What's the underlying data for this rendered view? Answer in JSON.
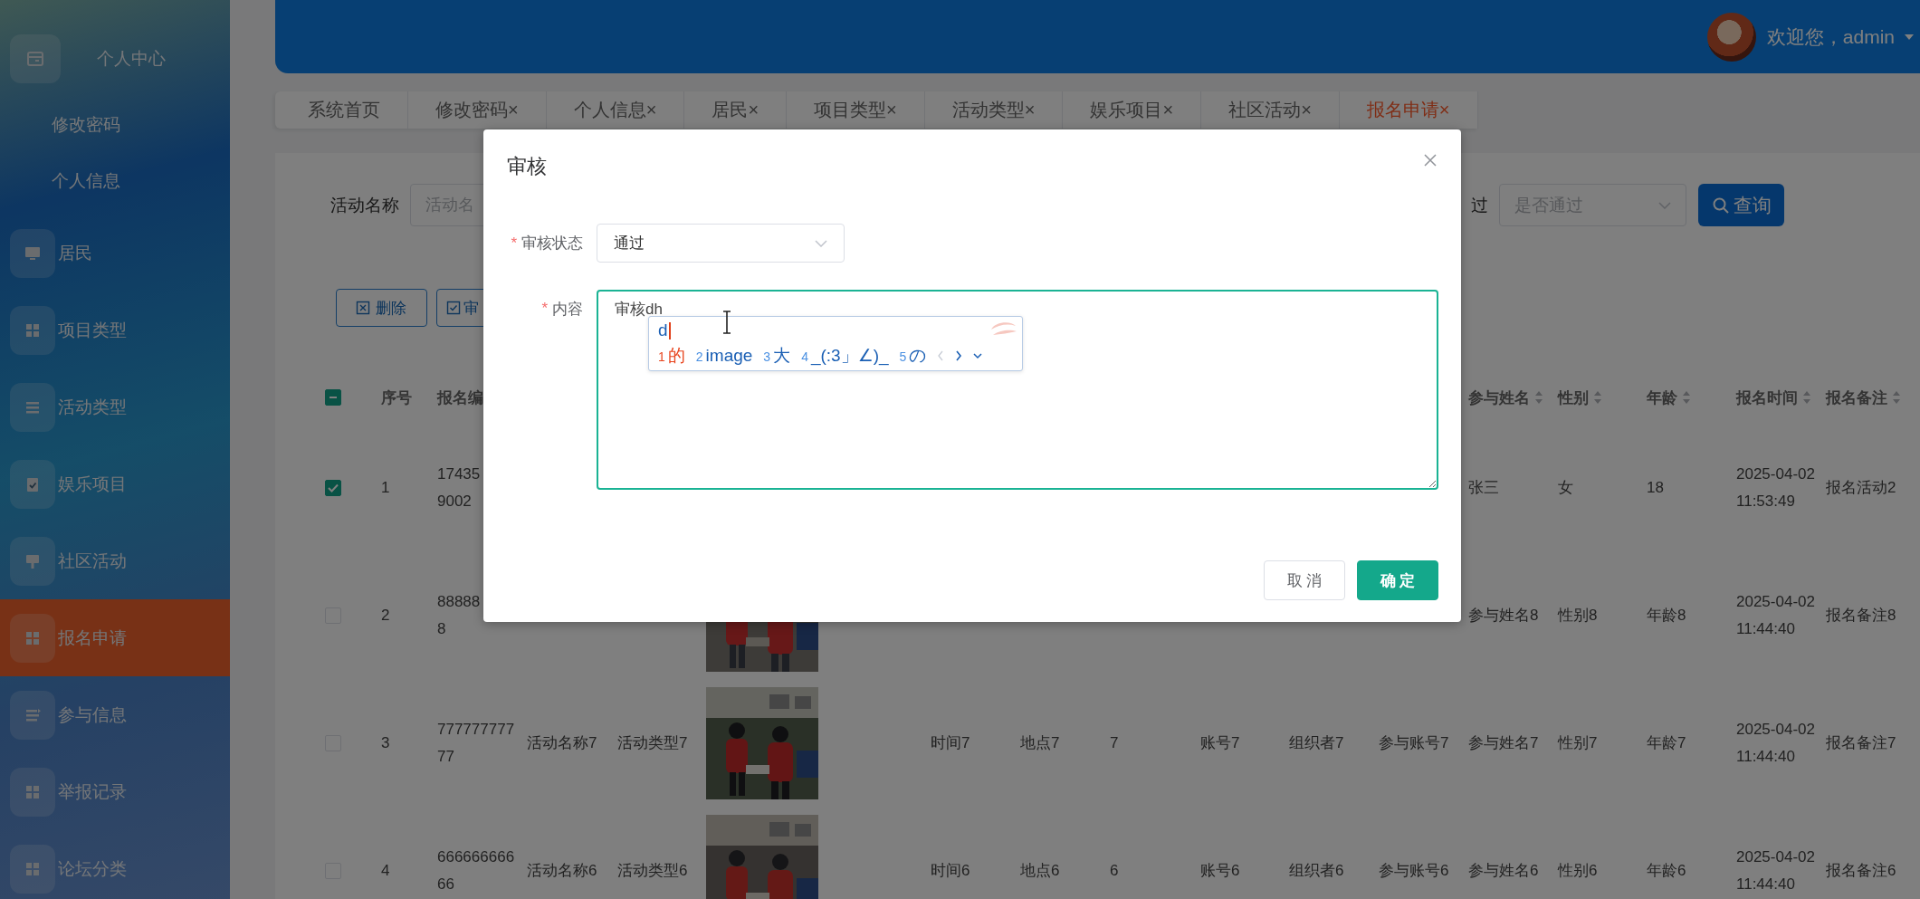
{
  "sidebar": {
    "items": [
      {
        "label": "个人中心",
        "selected": false,
        "children": [
          {
            "label": "修改密码"
          },
          {
            "label": "个人信息"
          }
        ]
      },
      {
        "label": "居民",
        "selected": false
      },
      {
        "label": "项目类型",
        "selected": false
      },
      {
        "label": "活动类型",
        "selected": false
      },
      {
        "label": "娱乐项目",
        "selected": false
      },
      {
        "label": "社区活动",
        "selected": false
      },
      {
        "label": "报名申请",
        "selected": true
      },
      {
        "label": "参与信息",
        "selected": false
      },
      {
        "label": "举报记录",
        "selected": false
      },
      {
        "label": "论坛分类",
        "selected": false
      }
    ]
  },
  "header": {
    "welcome": "欢迎您，admin"
  },
  "tabs": [
    {
      "label": "系统首页",
      "selected": false
    },
    {
      "label": "修改密码",
      "close": "×",
      "selected": false
    },
    {
      "label": "个人信息",
      "close": "×",
      "selected": false
    },
    {
      "label": "居民",
      "close": "×",
      "selected": false
    },
    {
      "label": "项目类型",
      "close": "×",
      "selected": false
    },
    {
      "label": "活动类型",
      "close": "×",
      "selected": false
    },
    {
      "label": "娱乐项目",
      "close": "×",
      "selected": false
    },
    {
      "label": "社区活动",
      "close": "×",
      "selected": false
    },
    {
      "label": "报名申请",
      "close": "×",
      "selected": true
    }
  ],
  "search": {
    "name_field": {
      "label": "活动名称",
      "placeholder": "活动名"
    },
    "approval_field": {
      "label": "过",
      "placeholder": "是否通过"
    },
    "button": "查询"
  },
  "actions": [
    {
      "kind": "delete",
      "label": "删除"
    },
    {
      "kind": "review",
      "label": "审"
    }
  ],
  "table": {
    "header_checkbox": {
      "indeterminate": true
    },
    "columns": [
      {
        "label": "序号",
        "sortable": false
      },
      {
        "label": "报名编",
        "sortable": false
      },
      null,
      null,
      null,
      null,
      null,
      null,
      null,
      null,
      null,
      {
        "label": "参与姓名",
        "sortable": true
      },
      {
        "label": "性别",
        "sortable": true
      },
      {
        "label": "年龄",
        "sortable": true
      },
      {
        "label": "报名时间",
        "sortable": true
      },
      {
        "label": "报名备注",
        "sortable": true
      }
    ],
    "rows": [
      {
        "selected": true,
        "cells": [
          "1",
          "17435\n9002",
          null,
          null,
          null,
          null,
          null,
          null,
          null,
          null,
          null,
          "张三",
          "女",
          "18",
          "2025-04-02 11:53:49",
          "报名活动2"
        ]
      },
      {
        "selected": false,
        "cells": [
          "2",
          "88888\n8",
          null,
          null,
          {
            "kind": "picture"
          },
          null,
          null,
          null,
          null,
          null,
          null,
          "参与姓名8",
          "性别8",
          "年龄8",
          "2025-04-02 11:44:40",
          "报名备注8"
        ]
      },
      {
        "selected": false,
        "cells": [
          "3",
          "77777777777",
          "活动名称7",
          "活动类型7",
          {
            "kind": "picture"
          },
          "时间7",
          "地点7",
          "7",
          "账号7",
          "组织者7",
          "参与账号7",
          "参与姓名7",
          "性别7",
          "年龄7",
          "2025-04-02 11:44:40",
          "报名备注7"
        ]
      },
      {
        "selected": false,
        "cells": [
          "4",
          "66666666666",
          "活动名称6",
          "活动类型6",
          {
            "kind": "picture"
          },
          "时间6",
          "地点6",
          "6",
          "账号6",
          "组织者6",
          "参与账号6",
          "参与姓名6",
          "性别6",
          "年龄6",
          "2025-04-02 11:44:40",
          "报名备注6"
        ]
      }
    ]
  },
  "dialog": {
    "title": "审核",
    "fields": [
      {
        "kind": "select",
        "required_mark": "*",
        "label": "审核状态",
        "value": "通过"
      },
      {
        "kind": "textarea",
        "required_mark": "*",
        "label": "内容",
        "value": "审核dh"
      }
    ],
    "ime": {
      "composition": "d",
      "candidates": [
        {
          "number": "1",
          "text": "的",
          "selected": true
        },
        {
          "number": "2",
          "text": "image",
          "selected": false
        },
        {
          "number": "3",
          "text": "大",
          "selected": false
        },
        {
          "number": "4",
          "text": "_(:3」∠)_",
          "selected": false
        },
        {
          "number": "5",
          "text": "の",
          "selected": false
        }
      ]
    },
    "buttons": [
      {
        "kind": "secondary",
        "label": "取 消"
      },
      {
        "kind": "primary",
        "label": "确 定"
      }
    ]
  }
}
